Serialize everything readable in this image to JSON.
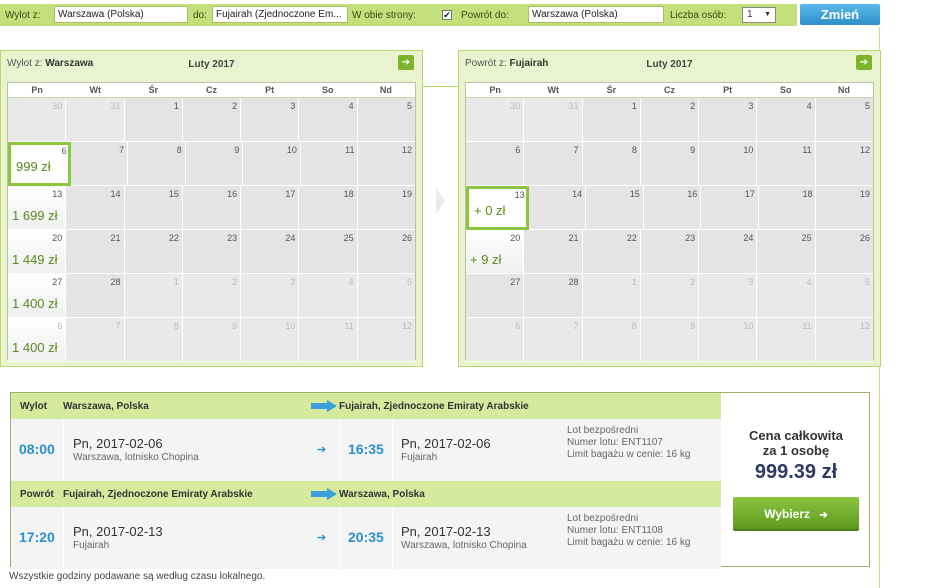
{
  "search": {
    "from_label": "Wylot z:",
    "from_value": "Warszawa (Polska)",
    "to_label": "do:",
    "to_value": "Fujairah (Zjednoczone Em...",
    "both_ways_label": "W obie strony:",
    "both_ways_checked": true,
    "return_from_label": "Powrót do:",
    "return_from_value": "Warszawa (Polska)",
    "persons_label": "Liczba osób:",
    "persons_value": "1",
    "change_button": "Zmień"
  },
  "calendar_out": {
    "title_prefix": "Wylot z:",
    "title_city": "Warszawa",
    "month": "Luty 2017",
    "weekdays": [
      "Pn",
      "Wt",
      "Śr",
      "Cz",
      "Pt",
      "So",
      "Nd"
    ],
    "weeks": [
      [
        {
          "d": "30",
          "o": true
        },
        {
          "d": "31",
          "o": true
        },
        {
          "d": "1"
        },
        {
          "d": "2"
        },
        {
          "d": "3"
        },
        {
          "d": "4"
        },
        {
          "d": "5"
        }
      ],
      [
        {
          "d": "6",
          "p": "999 zł",
          "s": true
        },
        {
          "d": "7"
        },
        {
          "d": "8"
        },
        {
          "d": "9"
        },
        {
          "d": "10"
        },
        {
          "d": "11"
        },
        {
          "d": "12"
        }
      ],
      [
        {
          "d": "13",
          "p": "1 699 zł"
        },
        {
          "d": "14"
        },
        {
          "d": "15"
        },
        {
          "d": "16"
        },
        {
          "d": "17"
        },
        {
          "d": "18"
        },
        {
          "d": "19"
        }
      ],
      [
        {
          "d": "20",
          "p": "1 449 zł"
        },
        {
          "d": "21"
        },
        {
          "d": "22"
        },
        {
          "d": "23"
        },
        {
          "d": "24"
        },
        {
          "d": "25"
        },
        {
          "d": "26"
        }
      ],
      [
        {
          "d": "27",
          "p": "1 400 zł"
        },
        {
          "d": "28"
        },
        {
          "d": "1",
          "o": true
        },
        {
          "d": "2",
          "o": true
        },
        {
          "d": "3",
          "o": true
        },
        {
          "d": "4",
          "o": true
        },
        {
          "d": "5",
          "o": true
        }
      ],
      [
        {
          "d": "6",
          "o": true,
          "p": "1 400 zł"
        },
        {
          "d": "7",
          "o": true
        },
        {
          "d": "8",
          "o": true
        },
        {
          "d": "9",
          "o": true
        },
        {
          "d": "10",
          "o": true
        },
        {
          "d": "11",
          "o": true
        },
        {
          "d": "12",
          "o": true
        }
      ]
    ]
  },
  "calendar_ret": {
    "title_prefix": "Powrót z:",
    "title_city": "Fujairah",
    "month": "Luty 2017",
    "weekdays": [
      "Pn",
      "Wt",
      "Śr",
      "Cz",
      "Pt",
      "So",
      "Nd"
    ],
    "weeks": [
      [
        {
          "d": "30",
          "o": true
        },
        {
          "d": "31",
          "o": true
        },
        {
          "d": "1"
        },
        {
          "d": "2"
        },
        {
          "d": "3"
        },
        {
          "d": "4"
        },
        {
          "d": "5"
        }
      ],
      [
        {
          "d": "6"
        },
        {
          "d": "7"
        },
        {
          "d": "8"
        },
        {
          "d": "9"
        },
        {
          "d": "10"
        },
        {
          "d": "11"
        },
        {
          "d": "12"
        }
      ],
      [
        {
          "d": "13",
          "p": "+ 0 zł",
          "s": true
        },
        {
          "d": "14"
        },
        {
          "d": "15"
        },
        {
          "d": "16"
        },
        {
          "d": "17"
        },
        {
          "d": "18"
        },
        {
          "d": "19"
        }
      ],
      [
        {
          "d": "20",
          "p": "+ 9 zł"
        },
        {
          "d": "21"
        },
        {
          "d": "22"
        },
        {
          "d": "23"
        },
        {
          "d": "24"
        },
        {
          "d": "25"
        },
        {
          "d": "26"
        }
      ],
      [
        {
          "d": "27"
        },
        {
          "d": "28"
        },
        {
          "d": "1",
          "o": true
        },
        {
          "d": "2",
          "o": true
        },
        {
          "d": "3",
          "o": true
        },
        {
          "d": "4",
          "o": true
        },
        {
          "d": "5",
          "o": true
        }
      ],
      [
        {
          "d": "6",
          "o": true
        },
        {
          "d": "7",
          "o": true
        },
        {
          "d": "8",
          "o": true
        },
        {
          "d": "9",
          "o": true
        },
        {
          "d": "10",
          "o": true
        },
        {
          "d": "11",
          "o": true
        },
        {
          "d": "12",
          "o": true
        }
      ]
    ]
  },
  "outbound": {
    "label": "Wylot",
    "from": "Warszawa, Polska",
    "to": "Fujairah, Zjednoczone Emiraty Arabskie",
    "dep_time": "08:00",
    "dep_date": "Pn, 2017-02-06",
    "dep_place": "Warszawa, lotnisko Chopina",
    "arr_time": "16:35",
    "arr_date": "Pn, 2017-02-06",
    "arr_place": "Fujairah",
    "info_direct": "Lot bezpośredni",
    "info_flight": "Numer lotu: ENT1107",
    "info_baggage": "Limit bagażu w cenie: 16 kg"
  },
  "inbound": {
    "label": "Powrót",
    "from": "Fujairah, Zjednoczone Emiraty Arabskie",
    "to": "Warszawa, Polska",
    "dep_time": "17:20",
    "dep_date": "Pn, 2017-02-13",
    "dep_place": "Fujairah",
    "arr_time": "20:35",
    "arr_date": "Pn, 2017-02-13",
    "arr_place": "Warszawa, lotnisko Chopina",
    "info_direct": "Lot bezpośredni",
    "info_flight": "Numer lotu: ENT1108",
    "info_baggage": "Limit bagażu w cenie: 16 kg"
  },
  "price": {
    "label_line1": "Cena całkowita",
    "label_line2": "za 1 osobę",
    "value": "999.39 zł",
    "select_button": "Wybierz"
  },
  "footnote": "Wszystkie godziny podawane są według czasu lokalnego.",
  "icons": {
    "next_month": "arrow-right-icon",
    "direction_big": "blue-arrow-icon",
    "direction_small": "small-arrow-icon",
    "dropdown": "chevron-down-icon"
  },
  "colors": {
    "accent_green": "#8cc63f",
    "header_green": "#d6ea9e",
    "time_blue": "#2b8fcb",
    "button_blue": "#2c8fc8",
    "price_navy": "#2d3a66"
  }
}
